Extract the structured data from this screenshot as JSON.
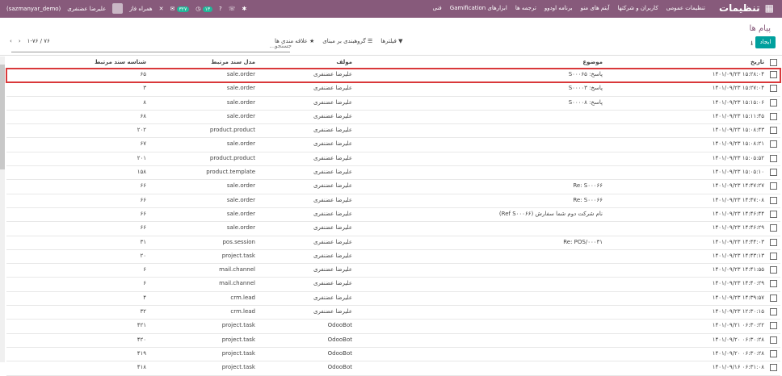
{
  "topbar": {
    "brand": "تنظیمات",
    "menu": [
      "تنظیمات عمومی",
      "کاربران و شرکتها",
      "آیتم های منو",
      "برنامه اودوو",
      "ترجمه ها",
      "ابزارهای Gamification",
      "فنی"
    ],
    "user_name": "علیرضا عضنفری",
    "company": "(sazmanyar_demo)",
    "mobile": "همراه فاز",
    "badge1": "۳۲۷",
    "badge2": "۱۳"
  },
  "control_panel": {
    "breadcrumb": "پیام ها",
    "search_placeholder": "جستجو...",
    "create_label": "ایجاد",
    "filters_label": "فیلترها",
    "groupby_label": "گروهبندی بر مبنای",
    "favorites_label": "علاقه مندی ها",
    "pager": "۱-۷۶ / ۷۶"
  },
  "table": {
    "headers": {
      "date": "تاریخ",
      "subject": "موضوع",
      "author": "مولف",
      "model": "مدل سند مرتبط",
      "res_id": "شناسه سند مرتبط"
    },
    "rows": [
      {
        "date": "۱۴۰۱/۰۹/۲۳ ۱۵:۲۸:۰۴",
        "subject": "پاسخ: S۰۰۰۶۵",
        "author": "علیرضا عضنفری",
        "model": "sale.order",
        "res_id": "۶۵"
      },
      {
        "date": "۱۴۰۱/۰۹/۲۳ ۱۵:۲۷:۰۴",
        "subject": "پاسخ: S۰۰۰۰۳",
        "author": "علیرضا عضنفری",
        "model": "sale.order",
        "res_id": "۳"
      },
      {
        "date": "۱۴۰۱/۰۹/۲۳ ۱۵:۱۵:۰۶",
        "subject": "پاسخ: S۰۰۰۰۸",
        "author": "علیرضا عضنفری",
        "model": "sale.order",
        "res_id": "۸"
      },
      {
        "date": "۱۴۰۱/۰۹/۲۳ ۱۵:۱۱:۴۵",
        "subject": "",
        "author": "علیرضا عضنفری",
        "model": "sale.order",
        "res_id": "۶۸"
      },
      {
        "date": "۱۴۰۱/۰۹/۲۳ ۱۵:۰۸:۴۳",
        "subject": "",
        "author": "علیرضا عضنفری",
        "model": "product.product",
        "res_id": "۲۰۲"
      },
      {
        "date": "۱۴۰۱/۰۹/۲۳ ۱۵:۰۸:۲۱",
        "subject": "",
        "author": "علیرضا عضنفری",
        "model": "sale.order",
        "res_id": "۶۷"
      },
      {
        "date": "۱۴۰۱/۰۹/۲۳ ۱۵:۰۵:۵۲",
        "subject": "",
        "author": "علیرضا عضنفری",
        "model": "product.product",
        "res_id": "۲۰۱"
      },
      {
        "date": "۱۴۰۱/۰۹/۲۳ ۱۵:۰۵:۱۰",
        "subject": "",
        "author": "علیرضا عضنفری",
        "model": "product.template",
        "res_id": "۱۵۸"
      },
      {
        "date": "۱۴۰۱/۰۹/۲۳ ۱۴:۴۷:۲۷",
        "subject": "Re: S۰۰۰۶۶",
        "author": "علیرضا عضنفری",
        "model": "sale.order",
        "res_id": "۶۶"
      },
      {
        "date": "۱۴۰۱/۰۹/۲۳ ۱۴:۴۷:۰۸",
        "subject": "Re: S۰۰۰۶۶",
        "author": "علیرضا عضنفری",
        "model": "sale.order",
        "res_id": "۶۶"
      },
      {
        "date": "۱۴۰۱/۰۹/۲۳ ۱۴:۴۶:۴۴",
        "subject": "نام شرکت دوم شما سفارش (Ref S۰۰۰۶۶)",
        "author": "علیرضا عضنفری",
        "model": "sale.order",
        "res_id": "۶۶"
      },
      {
        "date": "۱۴۰۱/۰۹/۲۳ ۱۴:۴۶:۲۹",
        "subject": "",
        "author": "علیرضا عضنفری",
        "model": "sale.order",
        "res_id": "۶۶"
      },
      {
        "date": "۱۴۰۱/۰۹/۲۳ ۱۴:۴۴:۰۳",
        "subject": "Re: POS/۰۰۰۳۱",
        "author": "علیرضا عضنفری",
        "model": "pos.session",
        "res_id": "۳۱"
      },
      {
        "date": "۱۴۰۱/۰۹/۲۳ ۱۴:۴۳:۱۳",
        "subject": "",
        "author": "علیرضا عضنفری",
        "model": "project.task",
        "res_id": "۲۰"
      },
      {
        "date": "۱۴۰۱/۰۹/۲۳ ۱۴:۴۱:۵۵",
        "subject": "",
        "author": "علیرضا عضنفری",
        "model": "mail.channel",
        "res_id": "۶"
      },
      {
        "date": "۱۴۰۱/۰۹/۲۳ ۱۴:۴۰:۲۹",
        "subject": "",
        "author": "علیرضا عضنفری",
        "model": "mail.channel",
        "res_id": "۶"
      },
      {
        "date": "۱۴۰۱/۰۹/۲۳ ۱۴:۳۹:۵۷",
        "subject": "",
        "author": "علیرضا عضنفری",
        "model": "crm.lead",
        "res_id": "۴"
      },
      {
        "date": "۱۴۰۱/۰۹/۲۳ ۱۲:۳۰:۱۵",
        "subject": "",
        "author": "علیرضا عضنفری",
        "model": "crm.lead",
        "res_id": "۳۲"
      },
      {
        "date": "۱۴۰۱/۰۹/۲۱ ۰۶:۳۰:۲۲",
        "subject": "",
        "author": "OdooBot",
        "model": "project.task",
        "res_id": "۴۲۱"
      },
      {
        "date": "۱۴۰۱/۰۹/۲۰ ۰۶:۳۰:۲۸",
        "subject": "",
        "author": "OdooBot",
        "model": "project.task",
        "res_id": "۴۲۰"
      },
      {
        "date": "۱۴۰۱/۰۹/۲۰ ۰۶:۳۰:۲۸",
        "subject": "",
        "author": "OdooBot",
        "model": "project.task",
        "res_id": "۴۱۹"
      },
      {
        "date": "۱۴۰۱/۰۹/۱۶ ۰۶:۳۱:۰۸",
        "subject": "",
        "author": "OdooBot",
        "model": "project.task",
        "res_id": "۴۱۸"
      }
    ]
  }
}
